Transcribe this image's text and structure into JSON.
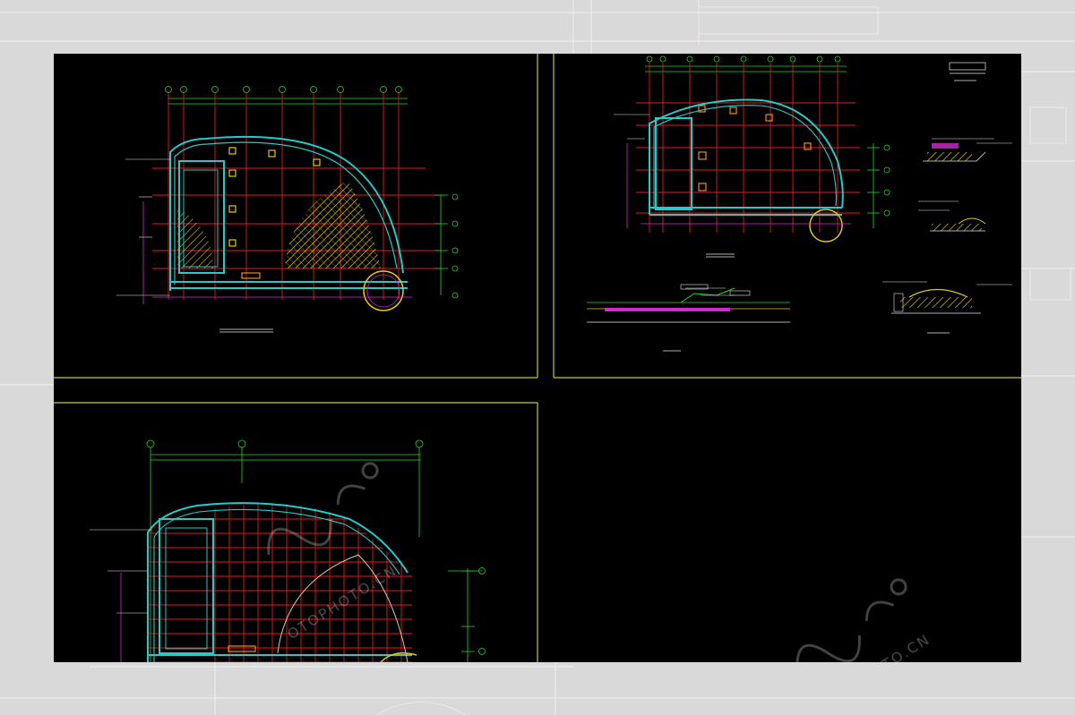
{
  "sheet": {
    "background_color": "#000000",
    "frame_color": "#c8c830",
    "panels": [
      {
        "id": "plan-1",
        "caption": "",
        "scale": ""
      },
      {
        "id": "plan-2",
        "caption": "",
        "scale": ""
      },
      {
        "id": "plan-3",
        "caption": "",
        "scale": ""
      }
    ]
  },
  "colors": {
    "grid_red": "#e21b1b",
    "wall_cyan": "#27c9c9",
    "dim_green": "#22d822",
    "hatch_yellow": "#e6c619",
    "white": "#e8e8e8",
    "magenta": "#d02ad0",
    "orange": "#f08a1c"
  },
  "watermark": {
    "text": "OTOPHOTO.CN",
    "logo_icon": "nipic-logo-icon"
  }
}
